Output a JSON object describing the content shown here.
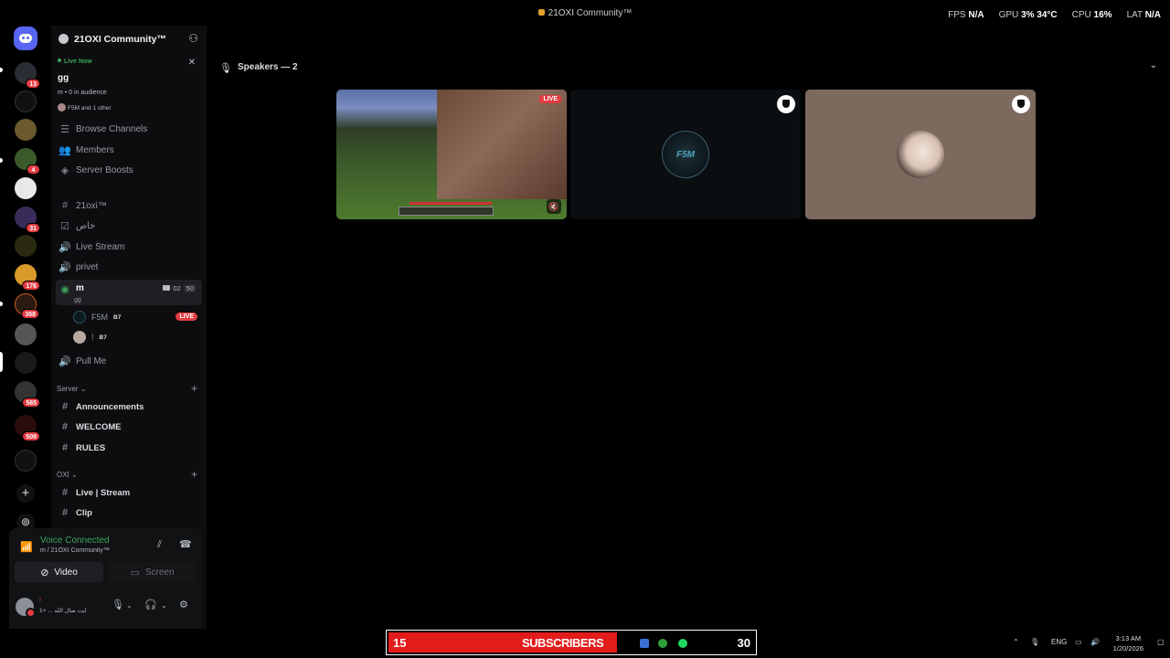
{
  "window": {
    "title": "21OXI Community™",
    "overlay": {
      "fps_label": "FPS",
      "fps_value": "N/A",
      "gpu_label": "GPU",
      "gpu_value": "3%",
      "gpu_temp": "34°C",
      "cpu_label": "CPU",
      "cpu_value": "16%",
      "lat_label": "LAT",
      "lat_value": "N/A"
    }
  },
  "rail": {
    "badges": [
      "13",
      "4",
      "31",
      "176",
      "368",
      "565",
      "509"
    ]
  },
  "server": {
    "name": "21OXI Community™",
    "live_card": {
      "status": "Live Now",
      "topic": "gg",
      "meta": "m • 0 in audience",
      "watching": "F5M and 1 other"
    },
    "nav": {
      "browse": "Browse Channels",
      "members": "Members",
      "boosts": "Server Boosts"
    },
    "channels": {
      "c1": "21oxi™",
      "c2": "خاص",
      "c3": "Live Stream",
      "c4": "privet",
      "active": {
        "name": "m",
        "sub": "gg",
        "count1": "02",
        "count2": "50"
      },
      "c6": "Pull Me"
    },
    "voice_users": [
      {
        "name": "F5M",
        "tag": "B7",
        "live": "LIVE"
      },
      {
        "name": "!",
        "tag": "B7"
      }
    ],
    "categories": {
      "server": "Server",
      "oxi": "OXI"
    },
    "server_channels": [
      "Announcements",
      "WELCOME",
      "RULES"
    ],
    "oxi_channels": [
      "Live | Stream",
      "Clip"
    ]
  },
  "voice_panel": {
    "status": "Voice Connected",
    "location": "m / 21OXI Community™",
    "video": "Video",
    "screen": "Screen",
    "user": {
      "name": "!",
      "status": "ايت صال الله ... +1"
    }
  },
  "stage": {
    "heading": "Speakers — 2",
    "tiles": {
      "live": "LIVE",
      "f5m_logo": "F5M"
    }
  },
  "taskbar": {
    "sub_current": "15",
    "sub_label": "SUBSCRIBERS",
    "sub_goal": "30",
    "lang": "ENG",
    "time": "3:13 AM",
    "date": "1/20/2026"
  }
}
